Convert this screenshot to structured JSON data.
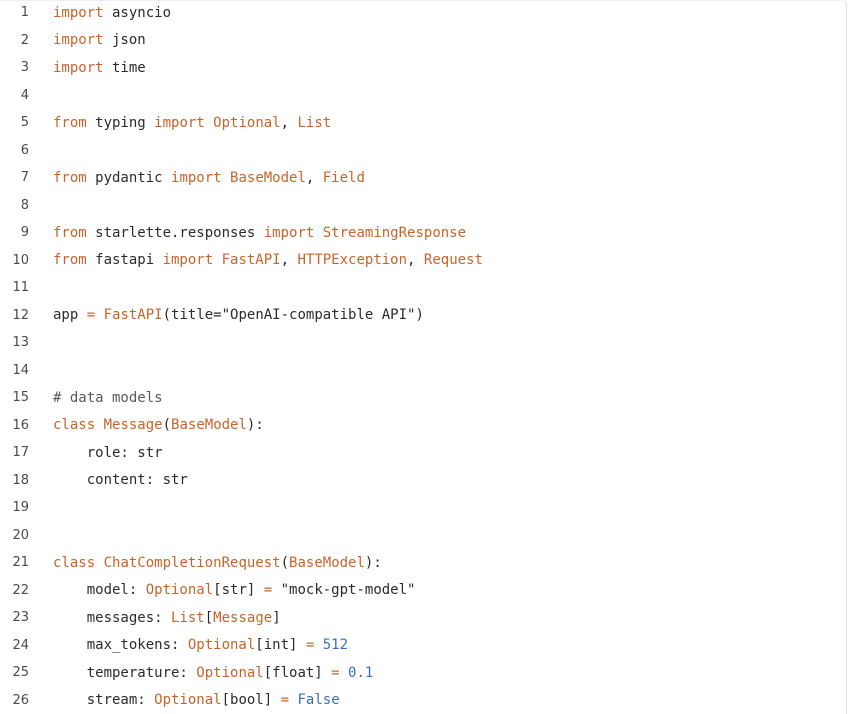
{
  "code_lines": [
    {
      "number": "1",
      "tokens": [
        {
          "t": "import",
          "k": "kw"
        },
        {
          "t": " asyncio",
          "k": "plain"
        }
      ]
    },
    {
      "number": "2",
      "tokens": [
        {
          "t": "import",
          "k": "kw"
        },
        {
          "t": " json",
          "k": "plain"
        }
      ]
    },
    {
      "number": "3",
      "tokens": [
        {
          "t": "import",
          "k": "kw"
        },
        {
          "t": " time",
          "k": "plain"
        }
      ]
    },
    {
      "number": "4",
      "tokens": []
    },
    {
      "number": "5",
      "tokens": [
        {
          "t": "from",
          "k": "kw"
        },
        {
          "t": " typing ",
          "k": "plain"
        },
        {
          "t": "import",
          "k": "kw"
        },
        {
          "t": " ",
          "k": "plain"
        },
        {
          "t": "Optional",
          "k": "cls"
        },
        {
          "t": ", ",
          "k": "plain"
        },
        {
          "t": "List",
          "k": "cls"
        }
      ]
    },
    {
      "number": "6",
      "tokens": []
    },
    {
      "number": "7",
      "tokens": [
        {
          "t": "from",
          "k": "kw"
        },
        {
          "t": " pydantic ",
          "k": "plain"
        },
        {
          "t": "import",
          "k": "kw"
        },
        {
          "t": " ",
          "k": "plain"
        },
        {
          "t": "BaseModel",
          "k": "cls"
        },
        {
          "t": ", ",
          "k": "plain"
        },
        {
          "t": "Field",
          "k": "cls"
        }
      ]
    },
    {
      "number": "8",
      "tokens": []
    },
    {
      "number": "9",
      "tokens": [
        {
          "t": "from",
          "k": "kw"
        },
        {
          "t": " starlette.responses ",
          "k": "plain"
        },
        {
          "t": "import",
          "k": "kw"
        },
        {
          "t": " ",
          "k": "plain"
        },
        {
          "t": "StreamingResponse",
          "k": "cls"
        }
      ]
    },
    {
      "number": "10",
      "tokens": [
        {
          "t": "from",
          "k": "kw"
        },
        {
          "t": " fastapi ",
          "k": "plain"
        },
        {
          "t": "import",
          "k": "kw"
        },
        {
          "t": " ",
          "k": "plain"
        },
        {
          "t": "FastAPI",
          "k": "cls"
        },
        {
          "t": ", ",
          "k": "plain"
        },
        {
          "t": "HTTPException",
          "k": "cls"
        },
        {
          "t": ", ",
          "k": "plain"
        },
        {
          "t": "Request",
          "k": "cls"
        }
      ]
    },
    {
      "number": "11",
      "tokens": []
    },
    {
      "number": "12",
      "tokens": [
        {
          "t": "app ",
          "k": "plain"
        },
        {
          "t": "=",
          "k": "op"
        },
        {
          "t": " ",
          "k": "plain"
        },
        {
          "t": "FastAPI",
          "k": "cls"
        },
        {
          "t": "(title=\"OpenAI-compatible API\")",
          "k": "str"
        }
      ]
    },
    {
      "number": "13",
      "tokens": []
    },
    {
      "number": "14",
      "tokens": []
    },
    {
      "number": "15",
      "tokens": [
        {
          "t": "# data models",
          "k": "com"
        }
      ]
    },
    {
      "number": "16",
      "tokens": [
        {
          "t": "class",
          "k": "kw"
        },
        {
          "t": " ",
          "k": "plain"
        },
        {
          "t": "Message",
          "k": "cls"
        },
        {
          "t": "(",
          "k": "plain"
        },
        {
          "t": "BaseModel",
          "k": "cls"
        },
        {
          "t": "):",
          "k": "plain"
        }
      ]
    },
    {
      "number": "17",
      "tokens": [
        {
          "t": "    role: str",
          "k": "plain"
        }
      ]
    },
    {
      "number": "18",
      "tokens": [
        {
          "t": "    content: str",
          "k": "plain"
        }
      ]
    },
    {
      "number": "19",
      "tokens": []
    },
    {
      "number": "20",
      "tokens": []
    },
    {
      "number": "21",
      "tokens": [
        {
          "t": "class",
          "k": "kw"
        },
        {
          "t": " ",
          "k": "plain"
        },
        {
          "t": "ChatCompletionRequest",
          "k": "cls"
        },
        {
          "t": "(",
          "k": "plain"
        },
        {
          "t": "BaseModel",
          "k": "cls"
        },
        {
          "t": "):",
          "k": "plain"
        }
      ]
    },
    {
      "number": "22",
      "tokens": [
        {
          "t": "    model: ",
          "k": "plain"
        },
        {
          "t": "Optional",
          "k": "cls"
        },
        {
          "t": "[str] ",
          "k": "plain"
        },
        {
          "t": "=",
          "k": "op"
        },
        {
          "t": " \"mock-gpt-model\"",
          "k": "str"
        }
      ]
    },
    {
      "number": "23",
      "tokens": [
        {
          "t": "    messages: ",
          "k": "plain"
        },
        {
          "t": "List",
          "k": "cls"
        },
        {
          "t": "[",
          "k": "plain"
        },
        {
          "t": "Message",
          "k": "cls"
        },
        {
          "t": "]",
          "k": "plain"
        }
      ]
    },
    {
      "number": "24",
      "tokens": [
        {
          "t": "    max_tokens: ",
          "k": "plain"
        },
        {
          "t": "Optional",
          "k": "cls"
        },
        {
          "t": "[int] ",
          "k": "plain"
        },
        {
          "t": "=",
          "k": "op"
        },
        {
          "t": " ",
          "k": "plain"
        },
        {
          "t": "512",
          "k": "num"
        }
      ]
    },
    {
      "number": "25",
      "tokens": [
        {
          "t": "    temperature: ",
          "k": "plain"
        },
        {
          "t": "Optional",
          "k": "cls"
        },
        {
          "t": "[float] ",
          "k": "plain"
        },
        {
          "t": "=",
          "k": "op"
        },
        {
          "t": " ",
          "k": "plain"
        },
        {
          "t": "0.1",
          "k": "num"
        }
      ]
    },
    {
      "number": "26",
      "tokens": [
        {
          "t": "    stream: ",
          "k": "plain"
        },
        {
          "t": "Optional",
          "k": "cls"
        },
        {
          "t": "[bool] ",
          "k": "plain"
        },
        {
          "t": "=",
          "k": "op"
        },
        {
          "t": " ",
          "k": "plain"
        },
        {
          "t": "False",
          "k": "const"
        }
      ]
    }
  ]
}
